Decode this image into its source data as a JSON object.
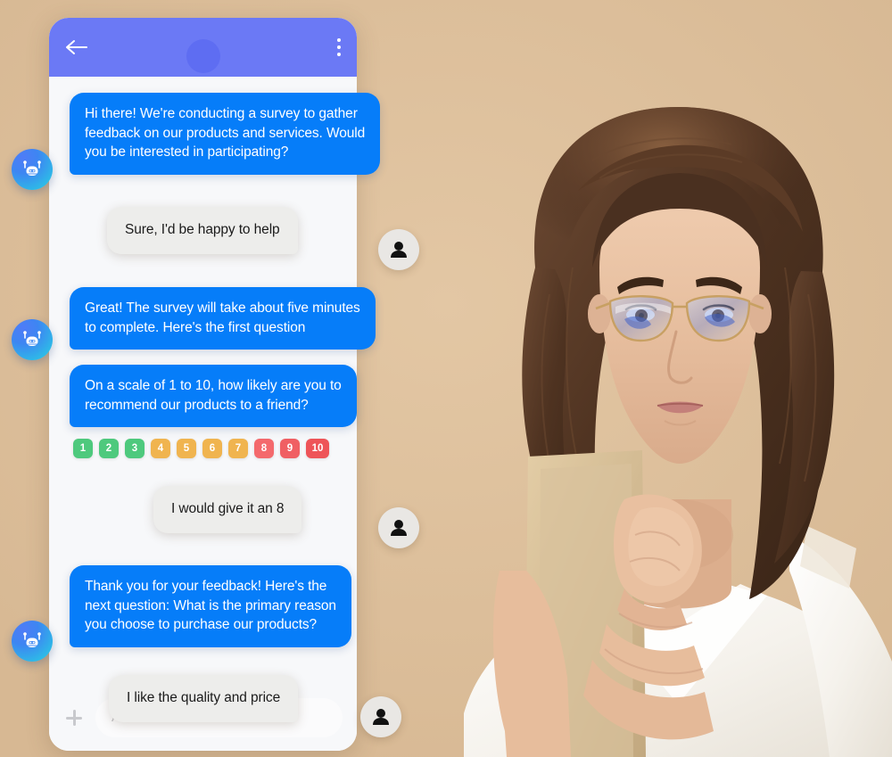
{
  "scene": {
    "background_color": "#dec09b",
    "description": "Chatbot survey conversation mockup over a photo of a woman with glasses using a smartphone"
  },
  "chat": {
    "header": {
      "back_icon": "arrow-left-icon",
      "avatar_icon": "contact-avatar-placeholder",
      "menu_icon": "overflow-menu-icon",
      "background_color": "#6b79f5"
    },
    "bot_avatar_icon": "robot-icon",
    "user_avatar_icon": "person-icon",
    "bubble_colors": {
      "bot": "#067df9",
      "user": "#ededeb"
    },
    "messages": [
      {
        "sender": "bot",
        "text": "Hi there! We're conducting a survey to gather\nfeedback on our products and services. Would\nyou be interested in participating?"
      },
      {
        "sender": "user",
        "text": "Sure, I'd be happy to help"
      },
      {
        "sender": "bot",
        "text": "Great! The survey will take about five minutes\nto complete. Here's the first question"
      },
      {
        "sender": "bot",
        "text": "On a scale of 1 to 10, how likely are you to\nrecommend our products to a friend?"
      },
      {
        "sender": "user",
        "text": "I would give it an 8"
      },
      {
        "sender": "bot",
        "text": "Thank you for your feedback! Here's the\nnext question: What is the primary reason\nyou choose to purchase our products?"
      },
      {
        "sender": "user",
        "text": "I like the quality and price"
      }
    ],
    "rating_scale": {
      "label": "nps-rating-1-to-10",
      "options": [
        {
          "value": "1",
          "color": "#4ec97d"
        },
        {
          "value": "2",
          "color": "#4ec97d"
        },
        {
          "value": "3",
          "color": "#4ec97d"
        },
        {
          "value": "4",
          "color": "#f0b44f"
        },
        {
          "value": "5",
          "color": "#f0b44f"
        },
        {
          "value": "6",
          "color": "#f0b44f"
        },
        {
          "value": "7",
          "color": "#f0b44f"
        },
        {
          "value": "8",
          "color": "#f4696c"
        },
        {
          "value": "9",
          "color": "#f05f63"
        },
        {
          "value": "10",
          "color": "#ee5458"
        }
      ]
    },
    "composer": {
      "add_icon": "plus-icon",
      "placeholder": "Aa"
    }
  }
}
